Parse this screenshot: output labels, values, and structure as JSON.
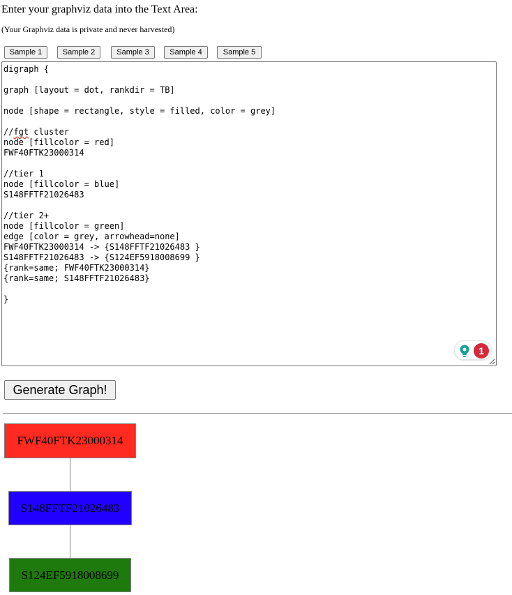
{
  "page": {
    "heading": "Enter your graphviz data into the Text Area:",
    "privacy_note": "(Your Graphviz data is private and never harvested)"
  },
  "samples": [
    {
      "label": "Sample 1"
    },
    {
      "label": "Sample 2"
    },
    {
      "label": "Sample 3"
    },
    {
      "label": "Sample 4"
    },
    {
      "label": "Sample 5"
    }
  ],
  "editor": {
    "lines": [
      "digraph {",
      "",
      "graph [layout = dot, rankdir = TB]",
      "",
      "node [shape = rectangle, style = filled, color = grey]",
      "",
      "//fgt cluster",
      "node [fillcolor = red]",
      "FWF40FTK23000314",
      "",
      "//tier 1",
      "node [fillcolor = blue]",
      "S148FFTF21026483",
      "",
      "//tier 2+",
      "node [fillcolor = green]",
      "edge [color = grey, arrowhead=none]",
      "FWF40FTK23000314 -> {S148FFTF21026483 }",
      "S148FFTF21026483 -> {S124EF5918008699 }",
      "{rank=same; FWF40FTK23000314}",
      "{rank=same; S148FFTF21026483}",
      "",
      "}"
    ],
    "spellcheck_word": "fgt",
    "assistant_badge_count": "1",
    "assistant_icon": "lightbulb-icon",
    "assistant_badge_color": "#d42a3a"
  },
  "generate_button": {
    "label": "Generate Graph!"
  },
  "graph": {
    "edge_color": "#808080",
    "border_color": "#808080",
    "nodes": [
      {
        "id": "FWF40FTK23000314",
        "label": "FWF40FTK23000314",
        "fill": "#ff2a20"
      },
      {
        "id": "S148FFTF21026483",
        "label": "S148FFTF21026483",
        "fill": "#2200ff"
      },
      {
        "id": "S124EF5918008699",
        "label": "S124EF5918008699",
        "fill": "#1e7a0c"
      }
    ],
    "edges": [
      {
        "from": "FWF40FTK23000314",
        "to": "S148FFTF21026483"
      },
      {
        "from": "S148FFTF21026483",
        "to": "S124EF5918008699"
      }
    ]
  }
}
